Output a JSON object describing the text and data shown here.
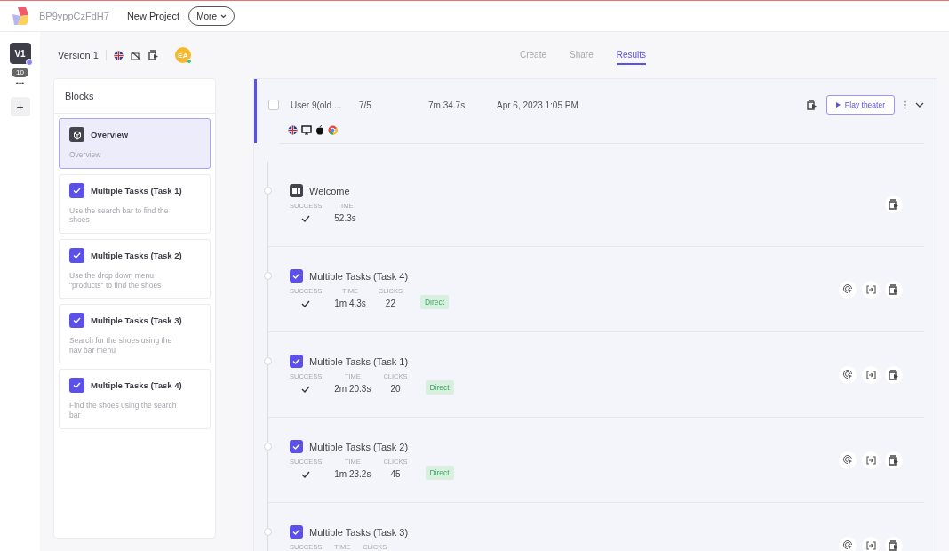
{
  "header": {
    "project_id": "BP9yppCzFdH7",
    "project_name": "New Project",
    "more_button": "More"
  },
  "rail": {
    "version_tile": "V1",
    "count": "10",
    "more": "•••",
    "add": "+"
  },
  "version": {
    "label": "Version 1",
    "avatar": "EA"
  },
  "tabs": [
    {
      "label": "Create",
      "selected": false
    },
    {
      "label": "Share",
      "selected": false
    },
    {
      "label": "Results",
      "selected": true
    }
  ],
  "blocks": {
    "title": "Blocks",
    "items": [
      {
        "kind": "overview",
        "title": "Overview",
        "description": "Overview",
        "selected": true
      },
      {
        "kind": "task",
        "title": "Multiple Tasks (Task 1)",
        "description": "Use the search bar to find the shoes",
        "selected": false
      },
      {
        "kind": "task",
        "title": "Multiple Tasks (Task 2)",
        "description": "Use the drop down menu \"products\" to find the shoes",
        "selected": false
      },
      {
        "kind": "task",
        "title": "Multiple Tasks (Task 3)",
        "description": "Search for the shoes using the nav bar menu",
        "selected": false
      },
      {
        "kind": "task",
        "title": "Multiple Tasks (Task 4)",
        "description": "Find the shoes using the search bar",
        "selected": false
      }
    ]
  },
  "session": {
    "checked": false,
    "user": "User 9(old ...",
    "score": "7/5",
    "duration": "7m 34.7s",
    "date": "Apr 6, 2023 1:05 PM",
    "play_button": "Play theater"
  },
  "steps": [
    {
      "kind": "welcome",
      "title": "Welcome",
      "metrics": [
        {
          "label": "SUCCESS",
          "success": true
        },
        {
          "label": "TIME",
          "value": "52.3s"
        }
      ]
    },
    {
      "kind": "task",
      "title": "Multiple Tasks (Task 4)",
      "metrics": [
        {
          "label": "SUCCESS",
          "success": true
        },
        {
          "label": "TIME",
          "value": "1m 4.3s"
        },
        {
          "label": "CLICKS",
          "value": "22"
        }
      ],
      "path": {
        "label": "Direct",
        "color": "#d9f0e1"
      }
    },
    {
      "kind": "task",
      "title": "Multiple Tasks (Task 1)",
      "metrics": [
        {
          "label": "SUCCESS",
          "success": true
        },
        {
          "label": "TIME",
          "value": "2m 20.3s"
        },
        {
          "label": "CLICKS",
          "value": "20"
        }
      ],
      "path": {
        "label": "Direct",
        "color": "#d9f0e1"
      }
    },
    {
      "kind": "task",
      "title": "Multiple Tasks (Task 2)",
      "metrics": [
        {
          "label": "SUCCESS",
          "success": true
        },
        {
          "label": "TIME",
          "value": "1m 23.2s"
        },
        {
          "label": "CLICKS",
          "value": "45"
        }
      ],
      "path": {
        "label": "Direct",
        "color": "#d9f0e1"
      }
    },
    {
      "kind": "task",
      "title": "Multiple Tasks (Task 3)",
      "metrics": [
        {
          "label": "SUCCESS"
        },
        {
          "label": "TIME"
        },
        {
          "label": "CLICKS"
        }
      ]
    }
  ]
}
